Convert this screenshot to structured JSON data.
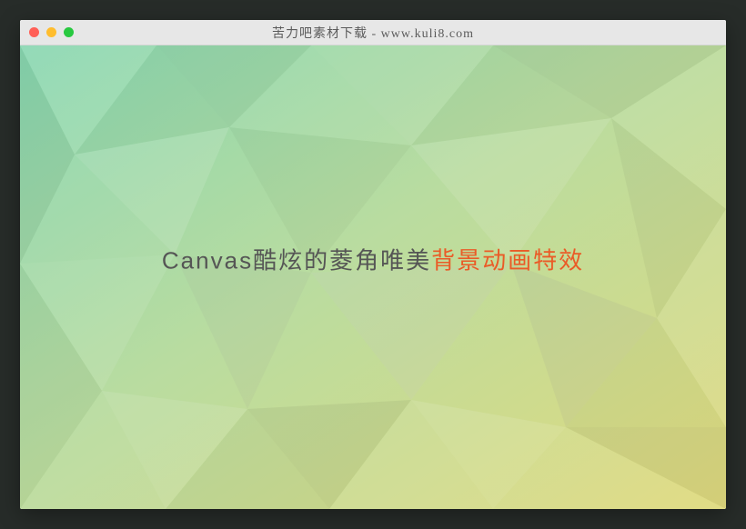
{
  "window": {
    "title": "苦力吧素材下载 - www.kuli8.com"
  },
  "headline": {
    "part1": "Canvas酷炫的菱角唯美",
    "part2": "背景动画特效"
  },
  "colors": {
    "page_bg": "#272c29",
    "accent": "#ea5b27",
    "text": "#555555"
  }
}
